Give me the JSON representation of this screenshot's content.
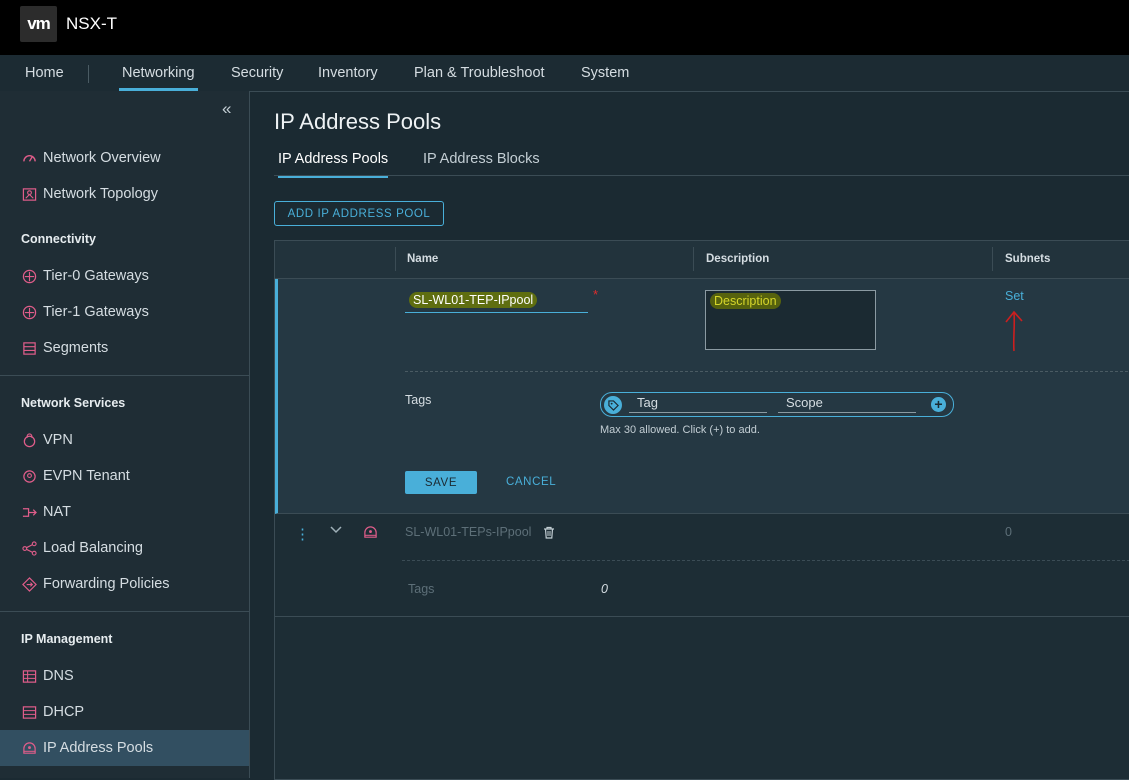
{
  "app": {
    "logo": "vm",
    "title": "NSX-T"
  },
  "nav": {
    "home": "Home",
    "networking": "Networking",
    "security": "Security",
    "inventory": "Inventory",
    "plan": "Plan & Troubleshoot",
    "system": "System",
    "active": "Networking"
  },
  "sidebar": {
    "collapse_icon": "double-chevron-left-icon",
    "network_overview": "Network Overview",
    "network_topology": "Network Topology",
    "connectivity_header": "Connectivity",
    "tier0": "Tier-0 Gateways",
    "tier1": "Tier-1 Gateways",
    "segments": "Segments",
    "services_header": "Network Services",
    "vpn": "VPN",
    "evpn": "EVPN Tenant",
    "nat": "NAT",
    "lb": "Load Balancing",
    "fp": "Forwarding Policies",
    "ipm_header": "IP Management",
    "dns": "DNS",
    "dhcp": "DHCP",
    "pools": "IP Address Pools",
    "active": "IP Address Pools"
  },
  "main": {
    "title": "IP Address Pools",
    "tab_pools": "IP Address Pools",
    "tab_blocks": "IP Address Blocks",
    "add_button": "ADD IP ADDRESS POOL"
  },
  "grid": {
    "col_name": "Name",
    "col_description": "Description",
    "col_subnets": "Subnets",
    "edit": {
      "name_value": "SL-WL01-TEP-IPpool",
      "required_mark": "*",
      "description_value": "Description",
      "subnets_link": "Set",
      "tags_label": "Tags",
      "tag_placeholder": "Tag",
      "scope_placeholder": "Scope",
      "tags_help": "Max 30 allowed. Click (+) to add.",
      "save": "SAVE",
      "cancel": "CANCEL"
    },
    "row": {
      "name": "SL-WL01-TEPs-IPpool",
      "subnets": "0",
      "tags_label": "Tags",
      "tags_count": "0"
    }
  },
  "colors": {
    "accent": "#49afd9",
    "icon_pink": "#e05d8a",
    "required": "#e02d2d",
    "annotation_arrow": "#cc1f1f"
  }
}
